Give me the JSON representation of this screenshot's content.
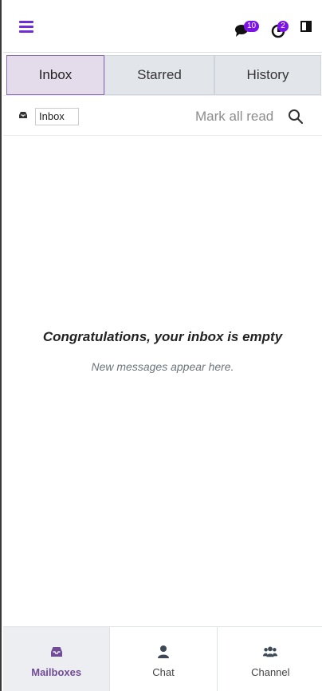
{
  "topbar": {
    "menu_icon": "hamburger-icon",
    "chat_icon": "comments-icon",
    "chat_count": "10",
    "activity_icon": "clock-icon",
    "activity_count": "2",
    "panel_icon": "split-panel-icon",
    "accent": "#7b12e8"
  },
  "tabs": [
    {
      "label": "Inbox",
      "active": true
    },
    {
      "label": "Starred",
      "active": false
    },
    {
      "label": "History",
      "active": false
    }
  ],
  "controls": {
    "mailbox_icon": "inbox-tray-icon",
    "mailbox_value": "Inbox",
    "mark_all_read": "Mark all read",
    "search_icon": "search-icon"
  },
  "empty": {
    "title": "Congratulations, your inbox is empty",
    "subtitle": "New messages appear here."
  },
  "bottom_nav": [
    {
      "label": "Mailboxes",
      "icon": "inbox-tray-icon",
      "active": true
    },
    {
      "label": "Chat",
      "icon": "user-icon",
      "active": false
    },
    {
      "label": "Channel",
      "icon": "users-icon",
      "active": false
    }
  ]
}
